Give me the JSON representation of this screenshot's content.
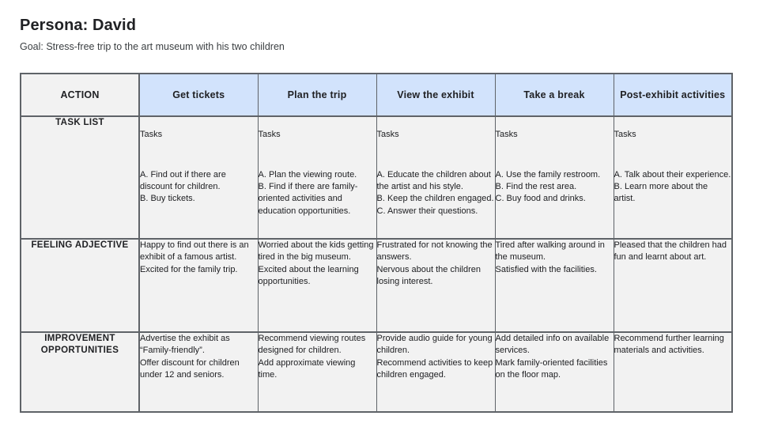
{
  "header": {
    "persona_title": "Persona: David",
    "goal": "Goal: Stress-free trip to the art museum with his two children"
  },
  "colors": {
    "stage_header_bg": "#d2e3fc",
    "cell_bg": "#f2f2f2",
    "border": "#5f6368",
    "text": "#202124",
    "page_bg": "#ffffff"
  },
  "table": {
    "corner_label": "ACTION",
    "stages": [
      "Get tickets",
      "Plan the trip",
      "View the exhibit",
      "Take a break",
      "Post-exhibit activities"
    ],
    "rows": [
      {
        "label": "TASK LIST",
        "tasks_heading": "Tasks",
        "cells": [
          "A. Find out if there are discount for children.\nB. Buy tickets.",
          "A. Plan the viewing route.\nB. Find if there are family-oriented activities and education opportunities.",
          "A. Educate the children about the artist and his style.\nB. Keep the children engaged.\nC. Answer their questions.",
          "A. Use the family restroom.\nB. Find the rest area.\nC. Buy food and drinks.",
          "A. Talk about their experience.\nB. Learn more about the artist."
        ]
      },
      {
        "label": "FEELING ADJECTIVE",
        "cells": [
          "Happy to find out there is an exhibit of a famous artist.\nExcited for the family trip.",
          "Worried about the kids getting tired in the big museum.\nExcited about the learning opportunities.",
          "Frustrated for not knowing the answers.\nNervous about the children losing interest.",
          "Tired after walking around in the museum.\nSatisfied with the facilities.",
          "Pleased that the children had fun and learnt about art."
        ]
      },
      {
        "label": "IMPROVEMENT OPPORTUNITIES",
        "cells": [
          "Advertise the exhibit as “Family-friendly”.\nOffer discount for children under 12 and seniors.",
          "Recommend viewing routes designed for children.\nAdd approximate viewing time.",
          "Provide audio guide for young children.\nRecommend activities to keep children engaged.",
          "Add detailed info on available services.\nMark family-oriented facilities on the floor map.",
          "Recommend further learning materials and activities."
        ]
      }
    ]
  }
}
